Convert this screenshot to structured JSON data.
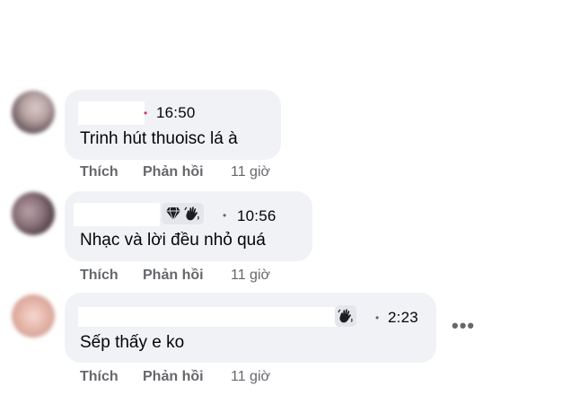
{
  "comments": [
    {
      "time": "16:50",
      "text": "Trinh hút thuoisc lá à",
      "actions": {
        "like": "Thích",
        "reply": "Phản hồi",
        "age": "11 giờ"
      },
      "badges": []
    },
    {
      "time": "10:56",
      "text": "Nhạc và lời đều nhỏ quá",
      "actions": {
        "like": "Thích",
        "reply": "Phản hồi",
        "age": "11 giờ"
      },
      "badges": [
        "diamond-icon",
        "wave-hand-icon"
      ]
    },
    {
      "time": "2:23",
      "text": "Sếp thấy e ko",
      "actions": {
        "like": "Thích",
        "reply": "Phản hồi",
        "age": "11 giờ"
      },
      "badges": [
        "wave-hand-icon"
      ]
    }
  ],
  "more_icon": "more-options-icon",
  "colors": {
    "bubble": "#f0f2f5",
    "secondary_text": "#65676b",
    "primary_text": "#050505",
    "accent_dot": "#c73a5a"
  }
}
